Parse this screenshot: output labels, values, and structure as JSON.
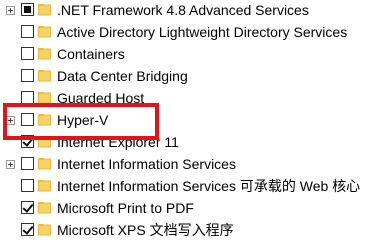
{
  "window": {
    "section": "Windows Features tree"
  },
  "colors": {
    "highlight_border": "#e0141b",
    "folder_fill": "#f7d367",
    "folder_tab": "#e9b93e"
  },
  "features": [
    {
      "label": ".NET Framework 4.8 Advanced Services",
      "state": "partial",
      "expandable": true,
      "icon": "folder-icon"
    },
    {
      "label": "Active Directory Lightweight Directory Services",
      "state": "unchecked",
      "expandable": false,
      "icon": "folder-icon"
    },
    {
      "label": "Containers",
      "state": "unchecked",
      "expandable": false,
      "icon": "folder-icon"
    },
    {
      "label": "Data Center Bridging",
      "state": "unchecked",
      "expandable": false,
      "icon": "folder-icon"
    },
    {
      "label": "Guarded Host",
      "state": "unchecked",
      "expandable": false,
      "icon": "folder-icon"
    },
    {
      "label": "Hyper-V",
      "state": "unchecked",
      "expandable": true,
      "icon": "folder-icon"
    },
    {
      "label": "Internet Explorer 11",
      "state": "checked",
      "expandable": false,
      "icon": "folder-icon"
    },
    {
      "label": "Internet Information Services",
      "state": "unchecked",
      "expandable": true,
      "icon": "folder-icon"
    },
    {
      "label": "Internet Information Services 可承载的 Web 核心",
      "state": "unchecked",
      "expandable": false,
      "icon": "folder-icon"
    },
    {
      "label": "Microsoft Print to PDF",
      "state": "checked",
      "expandable": false,
      "icon": "folder-icon"
    },
    {
      "label": "Microsoft XPS 文档写入程序",
      "state": "checked",
      "expandable": false,
      "icon": "folder-icon"
    }
  ]
}
